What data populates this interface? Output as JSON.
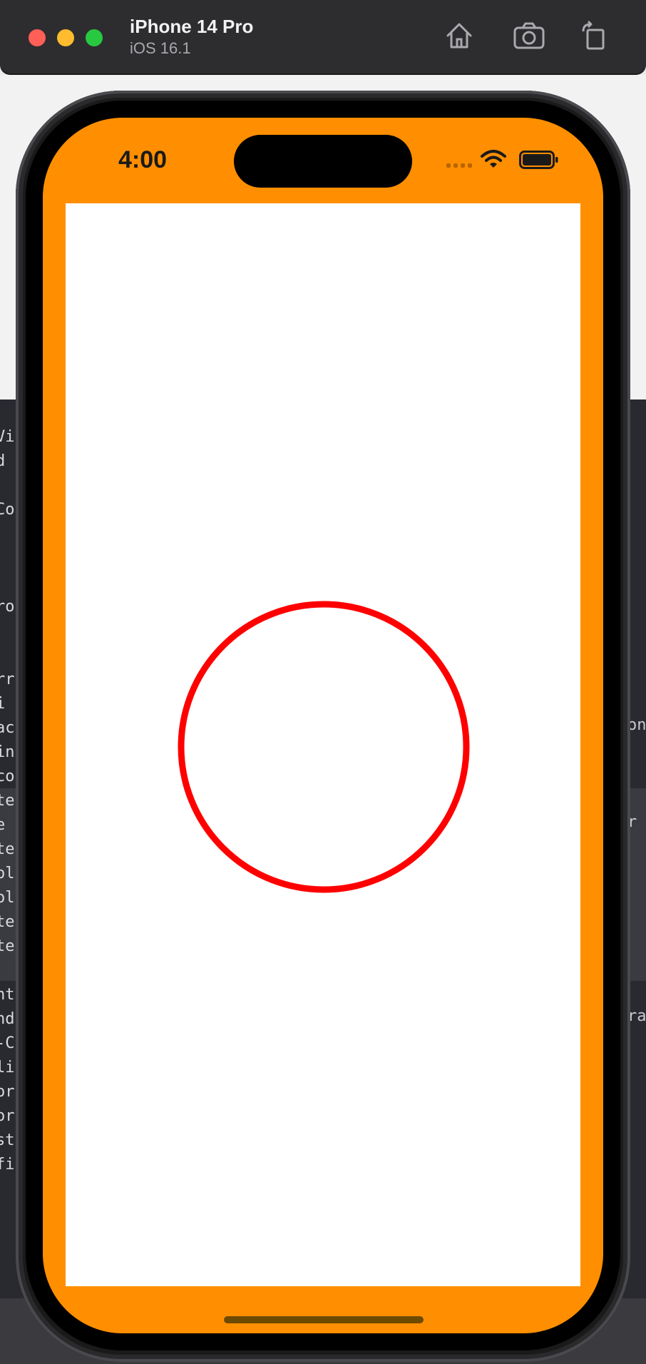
{
  "simulator": {
    "device_name": "iPhone 14 Pro",
    "os_version": "iOS 16.1",
    "toolbar": {
      "home_icon": "home-icon",
      "screenshot_icon": "camera-icon",
      "rotate_icon": "rotate-icon"
    }
  },
  "status_bar": {
    "time": "4:00"
  },
  "app": {
    "background_color": "#ff8f00",
    "content_color": "#ffffff",
    "shape": "circle",
    "stroke_color": "#ff0000"
  },
  "background_code": {
    "left_fragments": [
      "Vi",
      "d",
      "",
      "Co",
      "",
      "",
      "",
      "ro",
      "",
      "",
      "rr",
      "i",
      "ac",
      "in",
      "co",
      "te",
      "e",
      "te",
      "ol",
      "ol",
      "te",
      "te",
      "",
      "nt",
      "nd",
      "-C",
      "li",
      "or",
      "or",
      "st",
      "fi"
    ],
    "right_fragments": [
      "on",
      "",
      "",
      "",
      "r",
      "",
      "",
      "",
      "",
      "",
      "",
      "",
      "ra"
    ]
  }
}
